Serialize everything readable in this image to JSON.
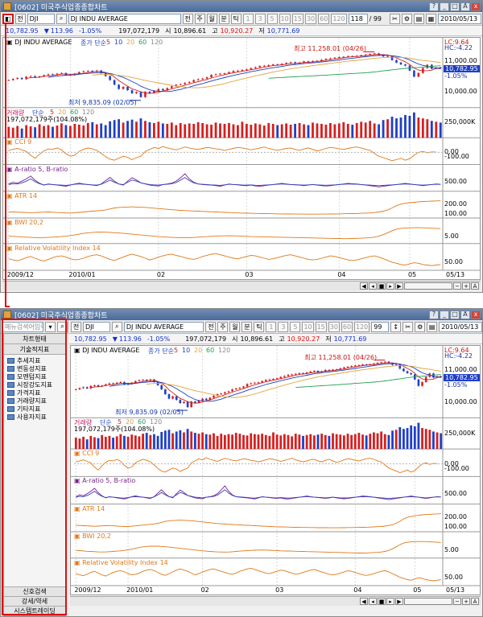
{
  "window": {
    "title": "[0602] 미국주식업종종합차트",
    "buttons": [
      "?",
      "_",
      "□",
      "A",
      "x"
    ]
  },
  "toolbar": {
    "mode_button": "전",
    "symbol_code": "DJI",
    "symbol_name": "DJ INDU AVERAGE",
    "period_buttons": [
      "주",
      "월",
      "분",
      "틱"
    ],
    "interval_buttons": [
      "1",
      "3",
      "5",
      "10",
      "15",
      "30",
      "60",
      "120"
    ],
    "count_value": "118",
    "count_total": "/ 99",
    "count_value_bottom": "99",
    "date": "2010/05/13"
  },
  "quote": {
    "price": "10,782.95",
    "arrow": "▼",
    "change": "113.96",
    "pct": "-1.05%",
    "volume": "197,072,179",
    "open_label": "시",
    "open": "10,896.61",
    "high_label": "고",
    "high": "10,920.27",
    "low_label": "저",
    "low": "10,771.69"
  },
  "sidebar": {
    "search_placeholder": "메뉴검색어입력",
    "header1": "차트형태",
    "header2": "기술적지표",
    "items": [
      "추세지표",
      "변동성지표",
      "모멘텀지표",
      "시장강도지표",
      "가격지표",
      "거래량지표",
      "기타지표",
      "사용자지표"
    ],
    "bottom": [
      "신호검색",
      "강세/약세",
      "시스템트레이딩"
    ]
  },
  "chart_data": {
    "type": "line",
    "title": "DJ INDU AVERAGE",
    "price_legend": {
      "prefix": "종가 단순",
      "periods": [
        "5",
        "10",
        "20",
        "60",
        "120"
      ],
      "colors": [
        "#cc2222",
        "#1a3fbf",
        "#e6a23a",
        "#22a050",
        "#888888"
      ]
    },
    "x_labels": [
      "2009/12",
      "2010/01",
      "02",
      "03",
      "04",
      "05",
      "05/13"
    ],
    "price_y_ticks": [
      "11,000.00",
      "10,000.00"
    ],
    "annotations": {
      "high": "최고 11,258.01 (04/26)",
      "low": "최저 9,835.09 (02/05)"
    },
    "right_labels": {
      "lc": "LC:9.64",
      "hc": "HC:-4.22",
      "last": "10,782.95",
      "pct": "-1.05%"
    },
    "price_ylim": [
      9600,
      11400
    ],
    "close": [
      10390,
      10430,
      10460,
      10420,
      10500,
      10520,
      10480,
      10510,
      10550,
      10580,
      10570,
      10600,
      10620,
      10550,
      10560,
      10600,
      10650,
      10680,
      10690,
      10660,
      10700,
      10620,
      10520,
      10390,
      10240,
      10100,
      10170,
      10060,
      9960,
      10000,
      9835,
      10010,
      9970,
      10040,
      10100,
      10060,
      10130,
      10190,
      10240,
      10260,
      10300,
      10330,
      10390,
      10420,
      10440,
      10480,
      10560,
      10580,
      10600,
      10610,
      10650,
      10690,
      10700,
      10720,
      10740,
      10780,
      10810,
      10850,
      10860,
      10880,
      10900,
      10880,
      10920,
      10950,
      10970,
      10930,
      10960,
      11000,
      10990,
      11010,
      11020,
      11050,
      11080,
      11100,
      11120,
      11140,
      11150,
      11170,
      11160,
      11180,
      11200,
      11220,
      11240,
      11258,
      11210,
      11160,
      11170,
      11040,
      10960,
      10900,
      10860,
      10700,
      10500,
      10620,
      10780,
      10890,
      10760,
      10800,
      10782
    ],
    "volume_legend": {
      "label": "거래량",
      "prefix": "단순",
      "periods": [
        "5",
        "20",
        "60",
        "120"
      ],
      "value": "197,072,179주(104.08%)"
    },
    "volume_y_tick": "250,000K",
    "volume": [
      130,
      120,
      140,
      110,
      150,
      135,
      125,
      160,
      140,
      150,
      130,
      145,
      170,
      150,
      140,
      165,
      155,
      145,
      175,
      185,
      160,
      170,
      150,
      195,
      210,
      220,
      180,
      200,
      215,
      190,
      230,
      200,
      185,
      175,
      190,
      170,
      165,
      180,
      150,
      175,
      160,
      170,
      165,
      185,
      175,
      160,
      155,
      180,
      170,
      165,
      175,
      160,
      150,
      190,
      165,
      155,
      170,
      160,
      145,
      175,
      165,
      150,
      160,
      170,
      155,
      165,
      175,
      160,
      150,
      180,
      170,
      165,
      155,
      175,
      160,
      170,
      185,
      165,
      155,
      175,
      190,
      180,
      200,
      170,
      160,
      210,
      220,
      250,
      230,
      240,
      270,
      260,
      300,
      240,
      230,
      220,
      200,
      190,
      180
    ],
    "indicators": [
      {
        "name": "CCI 9",
        "ticks": [
          "0.00",
          "-100.00"
        ]
      },
      {
        "name": "A-ratio 5, B-ratio",
        "ticks": [
          "500.00"
        ]
      },
      {
        "name": "ATR 14",
        "ticks": [
          "200.00",
          "100.00"
        ]
      },
      {
        "name": "BWI 20,2",
        "ticks": [
          "5.00"
        ]
      },
      {
        "name": "Relative Volatility Index 14",
        "ticks": [
          "50.00"
        ]
      }
    ],
    "series": [
      {
        "name": "CCI 9",
        "values": [
          40,
          60,
          80,
          50,
          20,
          -60,
          -120,
          -40,
          30,
          70,
          60,
          90,
          50,
          -30,
          -80,
          -60,
          20,
          60,
          90,
          70,
          40,
          -20,
          -90,
          -140,
          -160,
          -120,
          -80,
          -100,
          -150,
          -110,
          -80,
          20,
          60,
          100,
          80,
          120,
          90,
          70,
          50,
          80,
          110,
          90,
          70,
          60,
          80,
          100,
          90,
          70,
          60,
          40,
          60,
          80,
          100,
          90,
          70,
          50,
          70,
          90,
          110,
          80,
          60,
          40,
          60,
          80,
          90,
          60,
          40,
          70,
          90,
          60,
          30,
          50,
          80,
          100,
          90,
          70,
          60,
          80,
          100,
          110,
          90,
          60,
          40,
          -20,
          -80,
          -110,
          -140,
          -170,
          -150,
          -120,
          -160,
          -130,
          -60,
          0,
          20,
          -10,
          10,
          5
        ]
      },
      {
        "name": "A-ratio 5",
        "values": [
          420,
          480,
          450,
          520,
          600,
          700,
          550,
          450,
          380,
          420,
          400,
          380,
          360,
          340,
          380,
          420,
          450,
          420,
          400,
          380,
          360,
          420,
          540,
          650,
          520,
          420,
          380,
          520,
          640,
          560,
          460,
          420,
          380,
          360,
          350,
          400,
          420,
          450,
          520,
          640,
          780,
          600,
          480,
          420,
          400,
          390,
          380,
          360,
          340,
          380,
          420,
          400,
          390,
          370,
          360,
          380,
          350,
          340,
          360,
          380,
          400,
          420,
          440,
          420,
          400,
          390,
          380,
          360,
          380,
          400,
          380,
          360,
          350,
          360,
          380,
          400,
          420,
          440,
          430,
          420,
          400,
          380,
          360,
          340,
          320,
          340,
          360,
          380,
          400,
          420,
          440,
          420,
          400,
          380,
          360,
          380,
          400,
          420,
          410
        ]
      },
      {
        "name": "B-ratio",
        "values": [
          400,
          430,
          420,
          460,
          520,
          600,
          500,
          430,
          390,
          410,
          400,
          390,
          380,
          370,
          390,
          410,
          420,
          410,
          400,
          390,
          380,
          410,
          480,
          560,
          480,
          420,
          400,
          480,
          560,
          520,
          460,
          430,
          400,
          390,
          380,
          400,
          410,
          430,
          470,
          560,
          650,
          540,
          460,
          420,
          410,
          400,
          390,
          380,
          370,
          390,
          410,
          400,
          395,
          385,
          380,
          390,
          375,
          370,
          380,
          390,
          400,
          410,
          420,
          410,
          400,
          395,
          390,
          380,
          390,
          400,
          390,
          380,
          375,
          380,
          390,
          400,
          410,
          420,
          415,
          410,
          400,
          390,
          380,
          370,
          360,
          370,
          380,
          390,
          400,
          410,
          420,
          410,
          400,
          390,
          380,
          390,
          400,
          410,
          405
        ]
      },
      {
        "name": "ATR 14",
        "values": [
          120,
          118,
          116,
          114,
          112,
          110,
          112,
          114,
          116,
          118,
          115,
          112,
          110,
          108,
          106,
          110,
          114,
          118,
          122,
          126,
          130,
          134,
          140,
          150,
          160,
          165,
          168,
          170,
          172,
          170,
          168,
          166,
          162,
          158,
          154,
          150,
          146,
          142,
          138,
          135,
          132,
          130,
          128,
          126,
          124,
          122,
          120,
          118,
          116,
          114,
          112,
          110,
          108,
          106,
          105,
          104,
          103,
          102,
          101,
          100,
          99,
          98,
          98,
          97,
          97,
          96,
          96,
          96,
          95,
          95,
          95,
          96,
          96,
          97,
          97,
          98,
          99,
          100,
          101,
          102,
          104,
          106,
          108,
          112,
          118,
          126,
          140,
          160,
          185,
          200,
          210,
          215,
          220,
          225,
          228,
          230,
          232,
          234,
          236
        ]
      },
      {
        "name": "BWI 20,2",
        "values": [
          5,
          4.8,
          4.5,
          4.2,
          4,
          3.8,
          3.6,
          3.5,
          3.6,
          3.8,
          4,
          4.3,
          4.6,
          5,
          5.6,
          6.2,
          7,
          7.8,
          8.4,
          8.8,
          9,
          9.1,
          9,
          8.8,
          8.5,
          8.2,
          7.8,
          7.4,
          7,
          6.6,
          6.2,
          5.8,
          5.4,
          5,
          4.6,
          4.3,
          4,
          3.8,
          3.6,
          3.5,
          3.4,
          3.5,
          3.7,
          4,
          4.3,
          4.6,
          4.8,
          5,
          5.2,
          5.3,
          5.4,
          5.3,
          5.2,
          5,
          4.8,
          4.6,
          4.5,
          4.4,
          4.3,
          4.2,
          4.1,
          4,
          3.9,
          3.8,
          3.7,
          3.6,
          3.5,
          3.4,
          3.3,
          3.2,
          3.1,
          3,
          2.9,
          2.8,
          2.7,
          2.6,
          2.5,
          2.5,
          2.6,
          2.8,
          3,
          3.2,
          3.5,
          4,
          5,
          6.5,
          8.5,
          10.5,
          12,
          12.8,
          13.2,
          13.4,
          13.5,
          13.5,
          13.4,
          13.2,
          13,
          12.8,
          12.6
        ]
      },
      {
        "name": "Relative Volatility Index 14",
        "values": [
          62,
          58,
          55,
          60,
          66,
          70,
          64,
          58,
          54,
          60,
          66,
          70,
          72,
          68,
          62,
          58,
          60,
          64,
          70,
          74,
          76,
          72,
          66,
          60,
          56,
          62,
          68,
          74,
          78,
          74,
          70,
          64,
          58,
          62,
          68,
          72,
          76,
          78,
          74,
          70,
          66,
          62,
          60,
          64,
          70,
          74,
          78,
          80,
          76,
          72,
          68,
          64,
          62,
          66,
          70,
          74,
          72,
          68,
          64,
          60,
          62,
          66,
          70,
          74,
          76,
          72,
          68,
          64,
          60,
          58,
          60,
          64,
          68,
          72,
          70,
          66,
          62,
          58,
          56,
          58,
          62,
          66,
          70,
          72,
          68,
          62,
          56,
          50,
          46,
          42,
          40,
          44,
          48,
          46,
          42,
          40,
          38,
          40,
          42
        ]
      }
    ]
  }
}
